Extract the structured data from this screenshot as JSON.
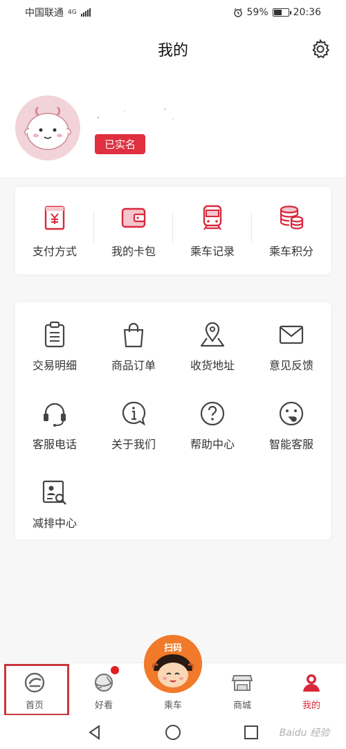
{
  "status_bar": {
    "carrier": "中国联通",
    "network": "4G",
    "battery": "59%",
    "battery_level": 0.59,
    "time": "20:36"
  },
  "header": {
    "title": "我的",
    "settings_icon": "gear-icon"
  },
  "profile": {
    "verified_label": "已实名",
    "avatar_icon": "dragon-avatar"
  },
  "quick_actions": [
    {
      "label": "支付方式",
      "icon": "payment-icon"
    },
    {
      "label": "我的卡包",
      "icon": "wallet-icon"
    },
    {
      "label": "乘车记录",
      "icon": "train-icon"
    },
    {
      "label": "乘车积分",
      "icon": "coins-icon"
    }
  ],
  "services": [
    {
      "label": "交易明细",
      "icon": "clipboard-icon"
    },
    {
      "label": "商品订单",
      "icon": "shopping-bag-icon"
    },
    {
      "label": "收货地址",
      "icon": "location-map-icon"
    },
    {
      "label": "意见反馈",
      "icon": "mail-icon"
    },
    {
      "label": "客服电话",
      "icon": "headset-icon"
    },
    {
      "label": "关于我们",
      "icon": "info-icon"
    },
    {
      "label": "帮助中心",
      "icon": "question-icon"
    },
    {
      "label": "智能客服",
      "icon": "chat-bot-icon"
    },
    {
      "label": "减排中心",
      "icon": "profile-search-icon"
    }
  ],
  "tab_bar": [
    {
      "label": "首页",
      "icon": "home-logo-icon"
    },
    {
      "label": "好看",
      "icon": "planet-icon"
    },
    {
      "label": "乘车",
      "icon": "scan-mascot-icon"
    },
    {
      "label": "商城",
      "icon": "store-icon"
    },
    {
      "label": "我的",
      "icon": "user-icon"
    }
  ],
  "scan_button": {
    "label": "扫码"
  },
  "watermark": "Baidu 经验",
  "colors": {
    "accent": "#d8283c",
    "badge": "#e0303f",
    "highlight_box": "#c8363c",
    "scan_orange": "#f07a2a"
  }
}
